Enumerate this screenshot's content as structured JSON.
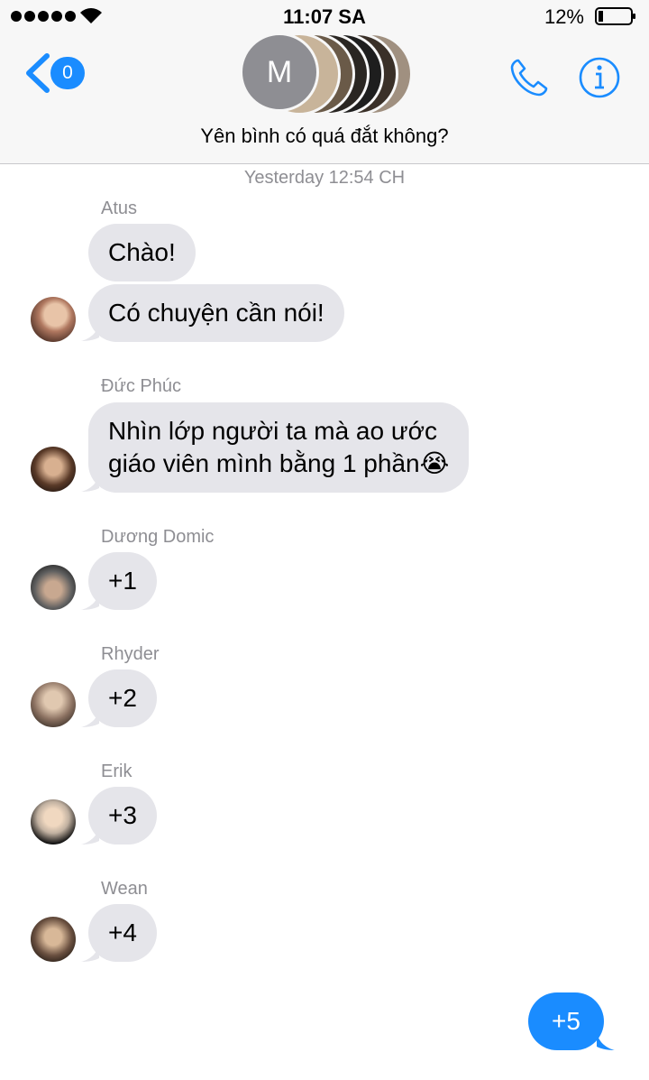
{
  "status_bar": {
    "time": "11:07 SA",
    "battery": "12%"
  },
  "header": {
    "back_badge": "0",
    "avatar_initial": "M",
    "group_name": "Yên bình có quá đắt không?"
  },
  "chat": {
    "timestamp": "Yesterday 12:54 CH",
    "messages": [
      {
        "sender": "Atus",
        "bubbles": [
          "Chào!",
          "Có chuyện cần nói!"
        ]
      },
      {
        "sender": "Đức Phúc",
        "bubbles": [
          "Nhìn lớp người ta mà ao ước",
          "giáo viên mình bằng 1 phần😭"
        ]
      },
      {
        "sender": "Dương Domic",
        "bubbles": [
          "+1"
        ]
      },
      {
        "sender": "Rhyder",
        "bubbles": [
          "+2"
        ]
      },
      {
        "sender": "Erik",
        "bubbles": [
          "+3"
        ]
      },
      {
        "sender": "Wean",
        "bubbles": [
          "+4"
        ]
      }
    ],
    "outgoing": "+5"
  },
  "colors": {
    "accent": "#1a8cff",
    "incoming_bubble": "#e5e5ea",
    "secondary_text": "#8e8e93"
  }
}
